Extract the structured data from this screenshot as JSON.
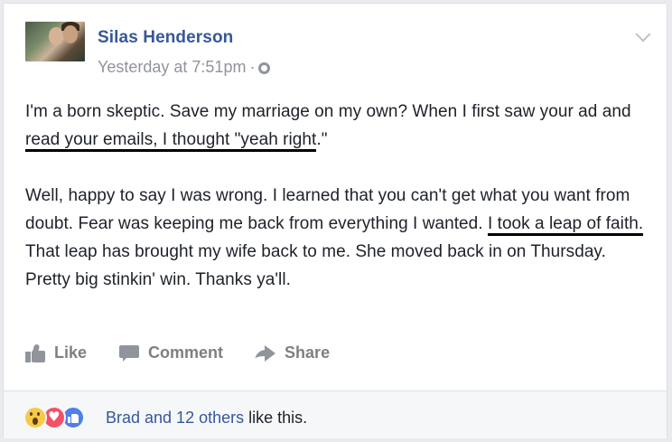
{
  "post": {
    "author": "Silas Henderson",
    "timestamp": "Yesterday at 7:51pm",
    "separator": "·",
    "privacy_icon": "globe-icon",
    "options_icon": "chevron-down-icon",
    "paragraph1": {
      "pre": "I'm a born skeptic. Save my marriage on my own? When I first saw your ad and ",
      "underlined": "read your emails, I thought \"yeah right",
      "post": ".\""
    },
    "paragraph2": {
      "pre": "Well, happy to say I was wrong. I learned that you can't get what you want from doubt. Fear was keeping me back from everything I wanted. ",
      "underlined": "I took a leap of faith.",
      "post": " That leap has brought my wife back to me. She moved back in on Thursday. Pretty big stinkin' win. Thanks ya'll."
    }
  },
  "actions": {
    "like_label": "Like",
    "comment_label": "Comment",
    "share_label": "Share"
  },
  "footer": {
    "reaction_icons": [
      "wow-icon",
      "love-icon",
      "like-icon"
    ],
    "liker_link": "Brad and 12 others",
    "liker_suffix": " like this."
  },
  "colors": {
    "link_blue": "#365899",
    "text": "#1d2129",
    "muted": "#90949c",
    "footer_bg": "#f6f7f9"
  }
}
